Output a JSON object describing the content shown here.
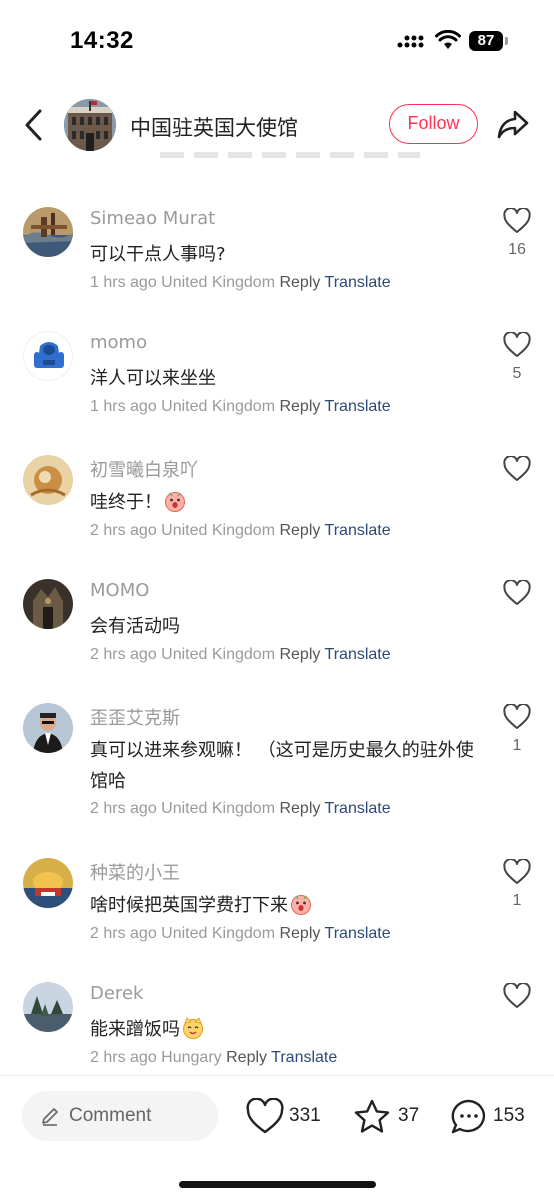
{
  "status_bar": {
    "time": "14:32",
    "battery": "87"
  },
  "header": {
    "title": "中国驻英国大使馆",
    "follow_label": "Follow"
  },
  "labels": {
    "reply": "Reply",
    "translate": "Translate"
  },
  "comments": [
    {
      "name": "Simeao Murat",
      "text": "可以干点人事吗?",
      "time": "1 hrs ago",
      "location": "United Kingdom",
      "likes": "16"
    },
    {
      "name": "momo",
      "text": "洋人可以来坐坐",
      "time": "1 hrs ago",
      "location": "United Kingdom",
      "likes": "5"
    },
    {
      "name": "初雪曦白泉吖",
      "text": "哇终于！",
      "time": "2 hrs ago",
      "location": "United Kingdom",
      "likes": ""
    },
    {
      "name": "MOMO",
      "text": "会有活动吗",
      "time": "2 hrs ago",
      "location": "United Kingdom",
      "likes": ""
    },
    {
      "name": "歪歪艾克斯",
      "text": "真可以进来参观嘛！ （这可是历史最久的驻外使馆哈",
      "time": "2 hrs ago",
      "location": "United Kingdom",
      "likes": "1"
    },
    {
      "name": "种菜的小王",
      "text": "啥时候把英国学费打下来",
      "time": "2 hrs ago",
      "location": "United Kingdom",
      "likes": "1"
    },
    {
      "name": "Derek",
      "text": "能来蹭饭吗",
      "time": "2 hrs ago",
      "location": "Hungary",
      "likes": ""
    }
  ],
  "bottom_bar": {
    "comment_placeholder": "Comment",
    "likes": "331",
    "stars": "37",
    "comments": "153"
  },
  "colors": {
    "accent": "#ff3355",
    "translate": "#2b4a7a",
    "meta": "#9a9a9a"
  },
  "icons": [
    "back-icon",
    "share-icon",
    "heart-icon",
    "star-icon",
    "chat-icon",
    "pencil-icon",
    "signal-icon",
    "wifi-icon",
    "battery-icon",
    "surprised-face-emoji",
    "cat-face-emoji"
  ]
}
